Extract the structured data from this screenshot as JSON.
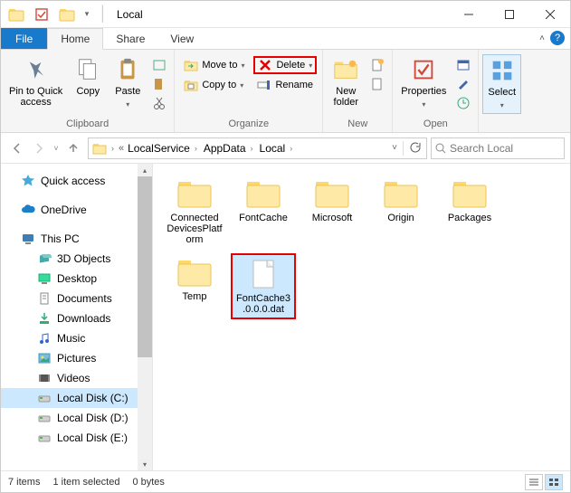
{
  "window": {
    "title": "Local"
  },
  "menutabs": {
    "file": "File",
    "tabs": [
      "Home",
      "Share",
      "View"
    ],
    "active": 0
  },
  "ribbon": {
    "clipboard": {
      "label": "Clipboard",
      "pin": "Pin to Quick\naccess",
      "copy": "Copy",
      "paste": "Paste"
    },
    "organize": {
      "label": "Organize",
      "moveto": "Move to",
      "copyto": "Copy to",
      "delete": "Delete",
      "rename": "Rename"
    },
    "new": {
      "label": "New",
      "newfolder": "New\nfolder"
    },
    "open": {
      "label": "Open",
      "properties": "Properties"
    },
    "select": {
      "label": "",
      "select": "Select"
    }
  },
  "breadcrumb": [
    "LocalService",
    "AppData",
    "Local"
  ],
  "search": {
    "placeholder": "Search Local"
  },
  "sidebar": {
    "quick": "Quick access",
    "onedrive": "OneDrive",
    "thispc": "This PC",
    "items": [
      "3D Objects",
      "Desktop",
      "Documents",
      "Downloads",
      "Music",
      "Pictures",
      "Videos",
      "Local Disk (C:)",
      "Local Disk (D:)",
      "Local Disk (E:)"
    ],
    "selected": 7
  },
  "files": [
    {
      "name": "Connected DevicesPlatform",
      "type": "folder"
    },
    {
      "name": "FontCache",
      "type": "folder"
    },
    {
      "name": "Microsoft",
      "type": "folder"
    },
    {
      "name": "Origin",
      "type": "folder"
    },
    {
      "name": "Packages",
      "type": "folder"
    },
    {
      "name": "Temp",
      "type": "folder"
    },
    {
      "name": "FontCache3.0.0.0.dat",
      "type": "file",
      "selected": true
    }
  ],
  "status": {
    "count": "7 items",
    "selected": "1 item selected",
    "size": "0 bytes"
  }
}
